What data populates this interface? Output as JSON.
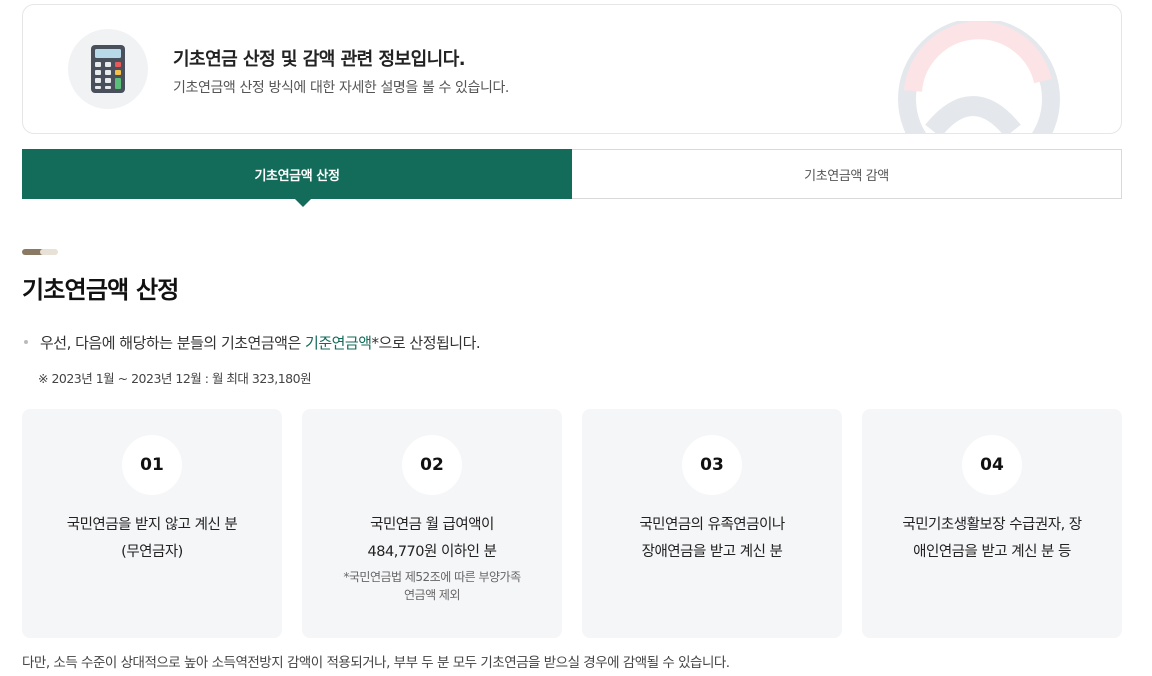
{
  "intro": {
    "title": "기초연금 산정 및 감액 관련 정보입니다.",
    "description": "기초연금액 산정 방식에 대한 자세한 설명을 볼 수 있습니다.",
    "icon": "calculator-icon",
    "emblem": "government-emblem"
  },
  "tabs": [
    {
      "label": "기초연금액 산정",
      "active": true
    },
    {
      "label": "기초연금액 감액",
      "active": false
    }
  ],
  "section": {
    "title": "기초연금액 산정",
    "bullet_prefix": "우선, 다음에 해당하는 분들의 기초연금액은 ",
    "bullet_highlight": "기준연금액",
    "bullet_suffix": "*으로 산정됩니다.",
    "note": "※ 2023년 1월 ~ 2023년 12월 : 월 최대 323,180원"
  },
  "cards": [
    {
      "num": "01",
      "line1": "국민연금을 받지 않고 계신 분",
      "line2": "(무연금자)",
      "sub1": "",
      "sub2": ""
    },
    {
      "num": "02",
      "line1": "국민연금 월 급여액이",
      "line2": "484,770원 이하인 분",
      "sub1": "*국민연금법 제52조에 따른 부양가족",
      "sub2": "연금액 제외"
    },
    {
      "num": "03",
      "line1": "국민연금의 유족연금이나",
      "line2": "장애연금을 받고 계신 분",
      "sub1": "",
      "sub2": ""
    },
    {
      "num": "04",
      "line1": "국민기초생활보장 수급권자, 장",
      "line2": "애인연금을 받고 계신 분 등",
      "sub1": "",
      "sub2": ""
    }
  ],
  "footer_note": "다만, 소득 수준이 상대적으로 높아 소득역전방지 감액이 적용되거나, 부부 두 분 모두 기초연금을 받으실 경우에 감액될 수 있습니다.",
  "colors": {
    "accent": "#136b5a",
    "card_bg": "#f5f6f8",
    "deco_dark": "#8a7a63"
  }
}
